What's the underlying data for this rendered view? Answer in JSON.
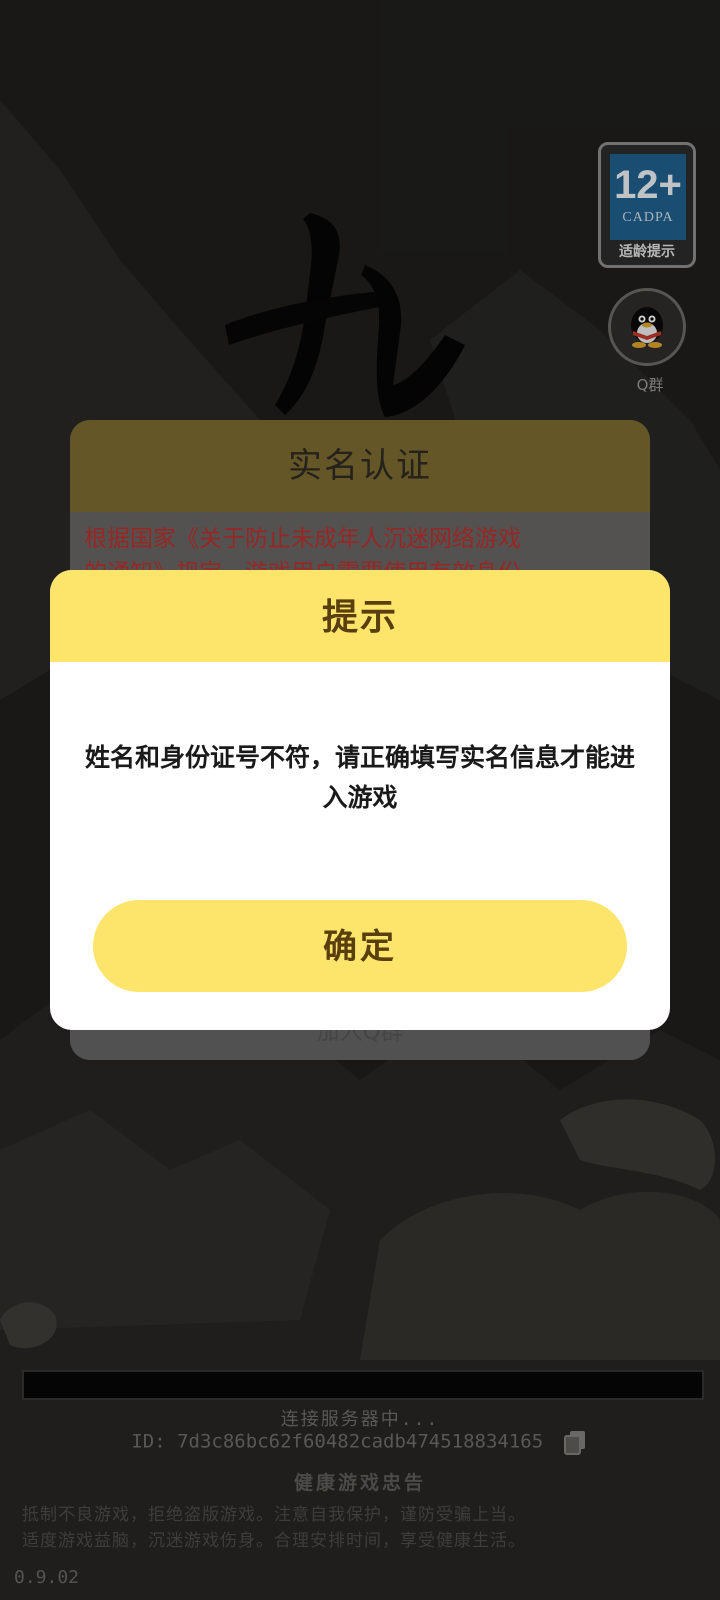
{
  "age_rating": {
    "age": "12+",
    "org": "CADPA",
    "tip": "适龄提示"
  },
  "qq_group": {
    "label": "Q群"
  },
  "background_dialog": {
    "title": "实名认证",
    "notice_line1": "根据国家《关于防止未成年人沉迷网络游戏",
    "notice_line2": "的通知》规定，游戏用户需要使用有效身份",
    "join_label": "加入Q群"
  },
  "modal": {
    "title": "提示",
    "message_line1": "姓名和身份证号不符，请正确填写实名信息才能进",
    "message_line2": "入游戏",
    "confirm_label": "确定"
  },
  "footer": {
    "status": "连接服务器中...",
    "device_id": "ID: 7d3c86bc62f60482cadb474518834165",
    "advice_title": "健康游戏忠告",
    "advice_line1": "抵制不良游戏，拒绝盗版游戏。注意自我保护，谨防受骗上当。",
    "advice_line2": "适度游戏益脑，沉迷游戏伤身。合理安排时间，享受健康生活。",
    "version": "0.9.02"
  },
  "colors": {
    "modal_yellow": "#fde46b",
    "modal_text_brown": "#5a3f0e",
    "notice_red": "#b8302c",
    "age_badge_blue": "#1f5f8b"
  },
  "icons": [
    "qq-penguin-icon",
    "copy-icon",
    "mountain-background",
    "calligraphy-logo"
  ]
}
